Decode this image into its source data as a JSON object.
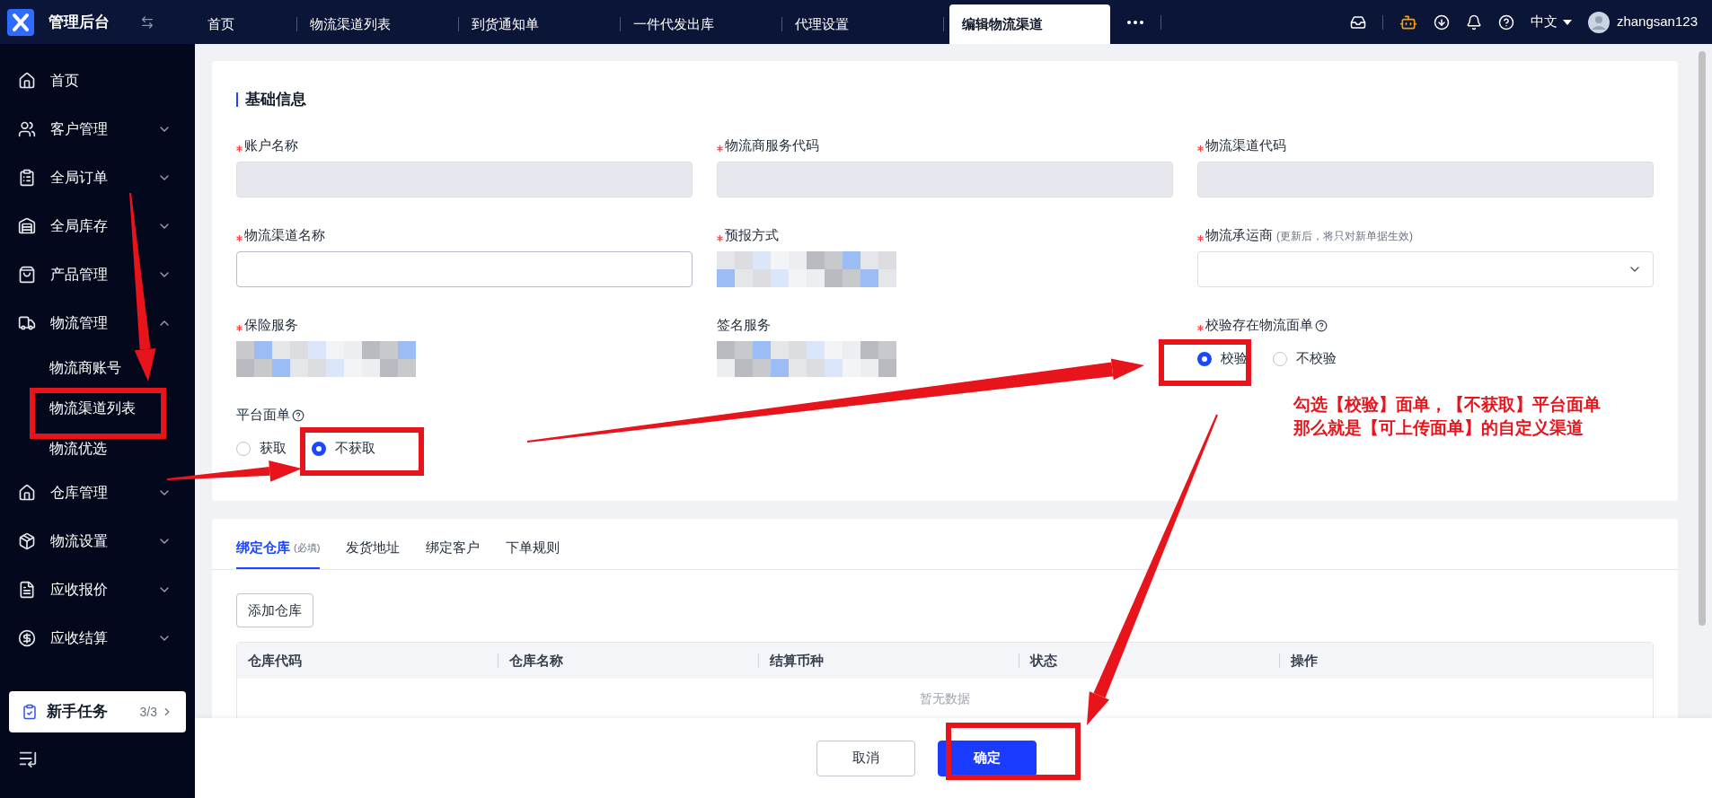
{
  "app": {
    "title": "管理后台"
  },
  "tabs": [
    {
      "label": "首页",
      "selected": false
    },
    {
      "label": "物流渠道列表",
      "selected": false
    },
    {
      "label": "到货通知单",
      "selected": false
    },
    {
      "label": "一件代发出库",
      "selected": false
    },
    {
      "label": "代理设置",
      "selected": false
    },
    {
      "label": "编辑物流渠道",
      "selected": true
    }
  ],
  "header": {
    "language": "中文",
    "user": "zhangsan123"
  },
  "sidebar": {
    "items": [
      {
        "label": "首页"
      },
      {
        "label": "客户管理",
        "expanded": false
      },
      {
        "label": "全局订单",
        "expanded": false
      },
      {
        "label": "全局库存",
        "expanded": false
      },
      {
        "label": "产品管理",
        "expanded": false
      },
      {
        "label": "物流管理",
        "expanded": true,
        "children": [
          {
            "label": "物流商账号"
          },
          {
            "label": "物流渠道列表"
          },
          {
            "label": "物流优选"
          }
        ]
      },
      {
        "label": "仓库管理",
        "expanded": false
      },
      {
        "label": "物流设置",
        "expanded": false
      },
      {
        "label": "应收报价",
        "expanded": false
      },
      {
        "label": "应收结算",
        "expanded": false
      }
    ],
    "task": {
      "label": "新手任务",
      "progress": "3/3"
    }
  },
  "form": {
    "title": "基础信息",
    "fields": [
      {
        "label": "账户名称",
        "required": true,
        "kind": "input",
        "disabled": true
      },
      {
        "label": "物流商服务代码",
        "required": true,
        "kind": "input",
        "disabled": true
      },
      {
        "label": "物流渠道代码",
        "required": true,
        "kind": "input",
        "disabled": true
      },
      {
        "label": "物流渠道名称",
        "required": true,
        "kind": "input",
        "disabled": false
      },
      {
        "label": "预报方式",
        "required": true,
        "kind": "value"
      },
      {
        "label": "物流承运商",
        "hint": "(更新后，将只对新单据生效)",
        "required": true,
        "kind": "select"
      },
      {
        "label": "保险服务",
        "required": true,
        "kind": "value"
      },
      {
        "label": "签名服务",
        "required": false,
        "kind": "value"
      },
      {
        "label": "校验存在物流面单",
        "required": true,
        "help": true,
        "kind": "radio",
        "options": [
          {
            "label": "校验",
            "selected": true
          },
          {
            "label": "不校验",
            "selected": false
          }
        ]
      },
      {
        "label": "平台面单",
        "required": false,
        "help": true,
        "kind": "radio",
        "options": [
          {
            "label": "获取",
            "selected": false
          },
          {
            "label": "不获取",
            "selected": true
          }
        ]
      }
    ]
  },
  "annotation": {
    "lines": [
      "勾选【校验】面单，【不获取】平台面单",
      "那么就是【可上传面单】的自定义渠道"
    ]
  },
  "bottom": {
    "tabs": [
      {
        "label": "绑定仓库",
        "note": "(必填)",
        "selected": true
      },
      {
        "label": "发货地址",
        "selected": false
      },
      {
        "label": "绑定客户",
        "selected": false
      },
      {
        "label": "下单规则",
        "selected": false
      }
    ],
    "add_button": "添加仓库",
    "table": {
      "columns": [
        "仓库代码",
        "仓库名称",
        "结算币种",
        "状态",
        "操作"
      ],
      "empty": "暂无数据"
    }
  },
  "footer": {
    "buttons": [
      {
        "label": "取消",
        "kind": "default"
      },
      {
        "label": "确定",
        "kind": "primary"
      }
    ]
  }
}
